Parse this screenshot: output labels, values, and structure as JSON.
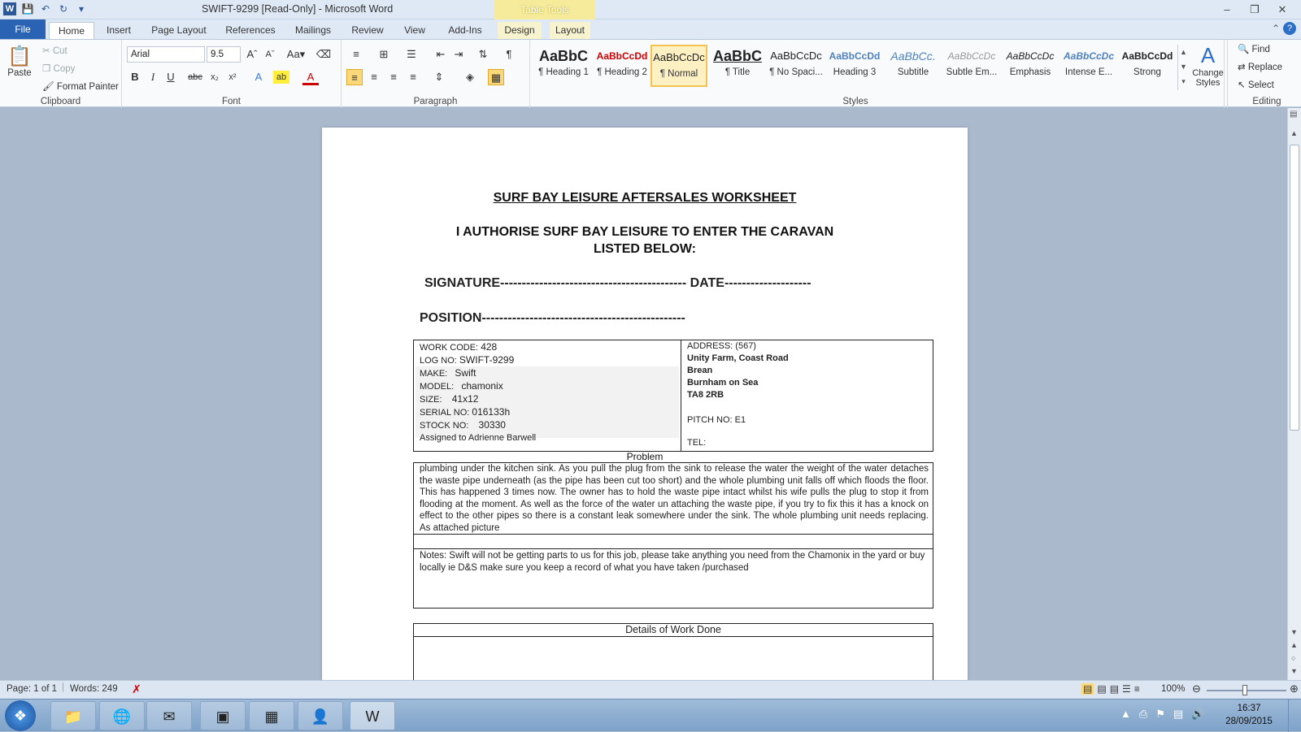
{
  "titlebar": {
    "title": "SWIFT-9299 [Read-Only] - Microsoft Word",
    "context_tab": "Table Tools"
  },
  "tabs": {
    "file": "File",
    "items": [
      "Home",
      "Insert",
      "Page Layout",
      "References",
      "Mailings",
      "Review",
      "View",
      "Add-Ins",
      "Design",
      "Layout"
    ]
  },
  "ribbon": {
    "clipboard": {
      "paste": "Paste",
      "cut": "Cut",
      "copy": "Copy",
      "format_painter": "Format Painter",
      "label": "Clipboard"
    },
    "font": {
      "name": "Arial",
      "size": "9.5",
      "label": "Font"
    },
    "paragraph": {
      "label": "Paragraph"
    },
    "styles": {
      "label": "Styles",
      "items": [
        {
          "preview": "AaBbC",
          "name": "¶ Heading 1"
        },
        {
          "preview": "AaBbCcDd",
          "name": "¶ Heading 2"
        },
        {
          "preview": "AaBbCcDc",
          "name": "¶ Normal"
        },
        {
          "preview": "AaBbC",
          "name": "¶ Title"
        },
        {
          "preview": "AaBbCcDc",
          "name": "¶ No Spaci..."
        },
        {
          "preview": "AaBbCcDd",
          "name": "Heading 3"
        },
        {
          "preview": "AaBbCc.",
          "name": "Subtitle"
        },
        {
          "preview": "AaBbCcDc",
          "name": "Subtle Em..."
        },
        {
          "preview": "AaBbCcDc",
          "name": "Emphasis"
        },
        {
          "preview": "AaBbCcDc",
          "name": "Intense E..."
        },
        {
          "preview": "AaBbCcDd",
          "name": "Strong"
        }
      ],
      "change_styles": "Change Styles"
    },
    "editing": {
      "find": "Find",
      "replace": "Replace",
      "select": "Select",
      "label": "Editing"
    }
  },
  "document": {
    "heading": "SURF BAY LEISURE AFTERSALES WORKSHEET",
    "authorise_line1": "I AUTHORISE SURF BAY LEISURE TO ENTER THE CARAVAN",
    "authorise_line2": "LISTED BELOW:",
    "signature": "SIGNATURE------------------------------------------- DATE--------------------",
    "position": "POSITION-----------------------------------------------",
    "left_fields": [
      {
        "label": "WORK CODE:",
        "value": "428"
      },
      {
        "label": "LOG NO:",
        "value": "SWIFT-9299"
      },
      {
        "label": "MAKE:",
        "value": "Swift"
      },
      {
        "label": "MODEL:",
        "value": "chamonix"
      },
      {
        "label": "SIZE:",
        "value": "41x12"
      },
      {
        "label": "SERIAL  NO:",
        "value": "016133h"
      },
      {
        "label": "STOCK NO:",
        "value": "30330"
      }
    ],
    "assigned": "Assigned to Adrienne Barwell",
    "address_label": "ADDRESS:  (567)",
    "address_lines": [
      "Unity Farm, Coast Road",
      "Brean",
      "Burnham on Sea",
      "TA8 2RB"
    ],
    "pitch": "PITCH NO:    E1",
    "tel": "TEL:",
    "problem_title": "Problem",
    "problem_text": "plumbing under the kitchen sink. As you pull the plug from the sink to release the water the weight of the water detaches the waste pipe underneath (as the pipe has been cut too short) and the whole plumbing unit falls off which floods the floor. This has happened 3 times now. The owner has to hold the waste pipe intact whilst his wife pulls the plug to stop it from flooding at the moment. As well as the force of the water un attaching the waste pipe, if you try to fix this it has a knock on effect to the other pipes so there is a constant leak somewhere under the sink. The whole plumbing unit needs replacing. As attached  picture",
    "notes": "Notes:  Swift will not be getting parts to us for this job, please take anything you need from the Chamonix in the yard or buy locally ie D&S make sure you keep a record of what you have taken /purchased",
    "details_title": "Details of Work Done"
  },
  "statusbar": {
    "page": "Page: 1 of 1",
    "words": "Words: 249",
    "zoom": "100%"
  },
  "taskbar": {
    "time": "16:37",
    "date": "28/09/2015"
  }
}
